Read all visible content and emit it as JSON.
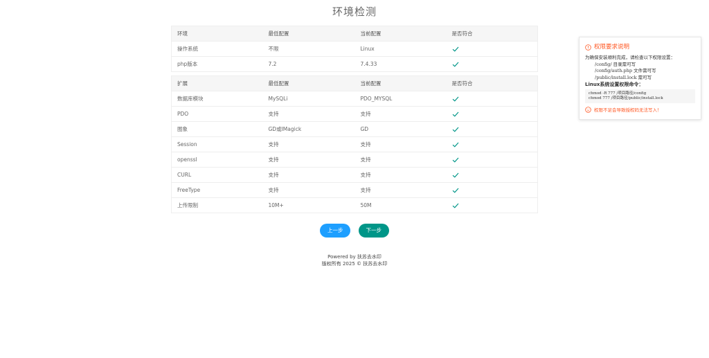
{
  "page_title": "环境检测",
  "env_table": {
    "headers": [
      "环境",
      "最低配置",
      "当前配置",
      "是否符合"
    ],
    "rows": [
      {
        "name": "操作系统",
        "min": "不限",
        "current": "Linux",
        "ok": true
      },
      {
        "name": "php版本",
        "min": "7.2",
        "current": "7.4.33",
        "ok": true
      }
    ]
  },
  "ext_table": {
    "headers": [
      "扩展",
      "最低配置",
      "当前配置",
      "是否符合"
    ],
    "rows": [
      {
        "name": "数据库模块",
        "min": "MySQLi",
        "current": "PDO_MYSQL",
        "ok": true
      },
      {
        "name": "PDO",
        "min": "支持",
        "current": "支持",
        "ok": true
      },
      {
        "name": "图象",
        "min": "GD或IMagick",
        "current": "GD",
        "ok": true
      },
      {
        "name": "Session",
        "min": "支持",
        "current": "支持",
        "ok": true
      },
      {
        "name": "openssl",
        "min": "支持",
        "current": "支持",
        "ok": true
      },
      {
        "name": "CURL",
        "min": "支持",
        "current": "支持",
        "ok": true
      },
      {
        "name": "FreeType",
        "min": "支持",
        "current": "支持",
        "ok": true
      },
      {
        "name": "上传限制",
        "min": "10M+",
        "current": "50M",
        "ok": true
      }
    ]
  },
  "buttons": {
    "prev": "上一步",
    "next": "下一步"
  },
  "footer": {
    "line1": "Powered by 扶苏去水印",
    "line2": "版权所有 2025 © 扶苏去水印"
  },
  "notice": {
    "title": "权限要求说明",
    "intro": "为确保安装顺利完成，请检查以下权限设置：",
    "paths": [
      "/config/ 目录需可写",
      "/config/auth.php 文件需可写",
      "/public/install.lock 需可写"
    ],
    "cmd_title": "Linux系统设置权限命令：",
    "commands": [
      "chmod -R 777 /项目路径/config",
      "chmod 777 /项目路径/public/install.lock"
    ],
    "warning": "权限不足会导致授权码无法写入！"
  },
  "colors": {
    "check": "#009688",
    "accent": "#ff5722",
    "prev": "#1e9fff",
    "next": "#009688"
  },
  "icons": {
    "ok": "check-icon",
    "info": "info-circle-icon",
    "warn": "sad-face-icon"
  }
}
